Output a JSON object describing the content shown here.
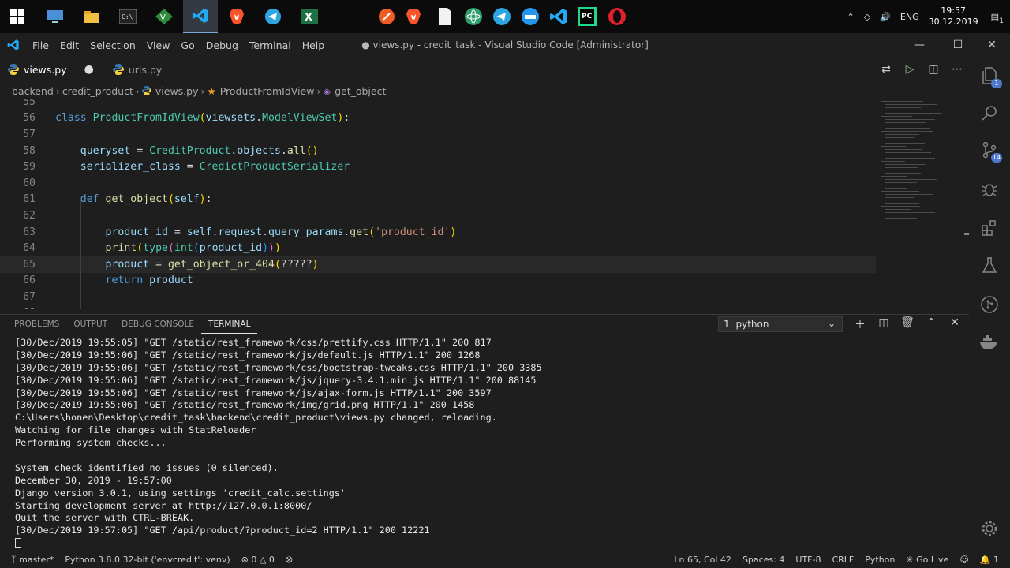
{
  "taskbar": {
    "language": "ENG",
    "time": "19:57",
    "date": "30.12.2019",
    "notifications_count": "1"
  },
  "titlebar": {
    "menu": [
      "File",
      "Edit",
      "Selection",
      "View",
      "Go",
      "Debug",
      "Terminal",
      "Help"
    ],
    "title": "● views.py - credit_task - Visual Studio Code [Administrator]"
  },
  "tabs": [
    {
      "label": "views.py",
      "active": true,
      "dirty": true
    },
    {
      "label": "urls.py",
      "active": false
    }
  ],
  "breadcrumb": [
    "backend",
    "credit_product",
    "views.py",
    "ProductFromIdView",
    "get_object"
  ],
  "editor": {
    "lines": [
      {
        "num": "55",
        "text": ""
      },
      {
        "num": "56",
        "text": "class ProductFromIdView(viewsets.ModelViewSet):"
      },
      {
        "num": "57",
        "text": ""
      },
      {
        "num": "58",
        "text": "    queryset = CreditProduct.objects.all()"
      },
      {
        "num": "59",
        "text": "    serializer_class = CredictProductSerializer"
      },
      {
        "num": "60",
        "text": ""
      },
      {
        "num": "61",
        "text": "    def get_object(self):"
      },
      {
        "num": "62",
        "text": ""
      },
      {
        "num": "63",
        "text": "        product_id = self.request.query_params.get('product_id')"
      },
      {
        "num": "64",
        "text": "        print(type(int(product_id)))"
      },
      {
        "num": "65",
        "text": "        product = get_object_or_404(?????)"
      },
      {
        "num": "66",
        "text": "        return product"
      },
      {
        "num": "67",
        "text": ""
      },
      {
        "num": "68",
        "text": ""
      }
    ]
  },
  "panel": {
    "tabs": [
      "PROBLEMS",
      "OUTPUT",
      "DEBUG CONSOLE",
      "TERMINAL"
    ],
    "active_tab": "TERMINAL",
    "terminal_select": "1: python",
    "terminal_lines": [
      "[30/Dec/2019 19:55:05] \"GET /static/rest_framework/css/prettify.css HTTP/1.1\" 200 817",
      "[30/Dec/2019 19:55:06] \"GET /static/rest_framework/js/default.js HTTP/1.1\" 200 1268",
      "[30/Dec/2019 19:55:06] \"GET /static/rest_framework/css/bootstrap-tweaks.css HTTP/1.1\" 200 3385",
      "[30/Dec/2019 19:55:06] \"GET /static/rest_framework/js/jquery-3.4.1.min.js HTTP/1.1\" 200 88145",
      "[30/Dec/2019 19:55:06] \"GET /static/rest_framework/js/ajax-form.js HTTP/1.1\" 200 3597",
      "[30/Dec/2019 19:55:06] \"GET /static/rest_framework/img/grid.png HTTP/1.1\" 200 1458",
      "C:\\Users\\honen\\Desktop\\credit_task\\backend\\credit_product\\views.py changed, reloading.",
      "Watching for file changes with StatReloader",
      "Performing system checks...",
      "",
      "System check identified no issues (0 silenced).",
      "December 30, 2019 - 19:57:00",
      "Django version 3.0.1, using settings 'credit_calc.settings'",
      "Starting development server at http://127.0.0.1:8000/",
      "Quit the server with CTRL-BREAK.",
      "[30/Dec/2019 19:57:05] \"GET /api/product/?product_id=2 HTTP/1.1\" 200 12221"
    ]
  },
  "activity": {
    "explorer_badge": "1",
    "scm_badge": "14"
  },
  "statusbar": {
    "branch": "master*",
    "interpreter": "Python 3.8.0 32-bit ('envcredit': venv)",
    "errors": "0",
    "warnings": "0",
    "position": "Ln 65, Col 42",
    "spaces": "Spaces: 4",
    "encoding": "UTF-8",
    "eol": "CRLF",
    "language": "Python",
    "golive": "Go Live",
    "notif": "1"
  },
  "colors": {
    "accent": "#007acc",
    "keyword": "#569cd6",
    "class": "#4ec9b0",
    "function": "#dcdcaa",
    "string": "#ce9178"
  }
}
